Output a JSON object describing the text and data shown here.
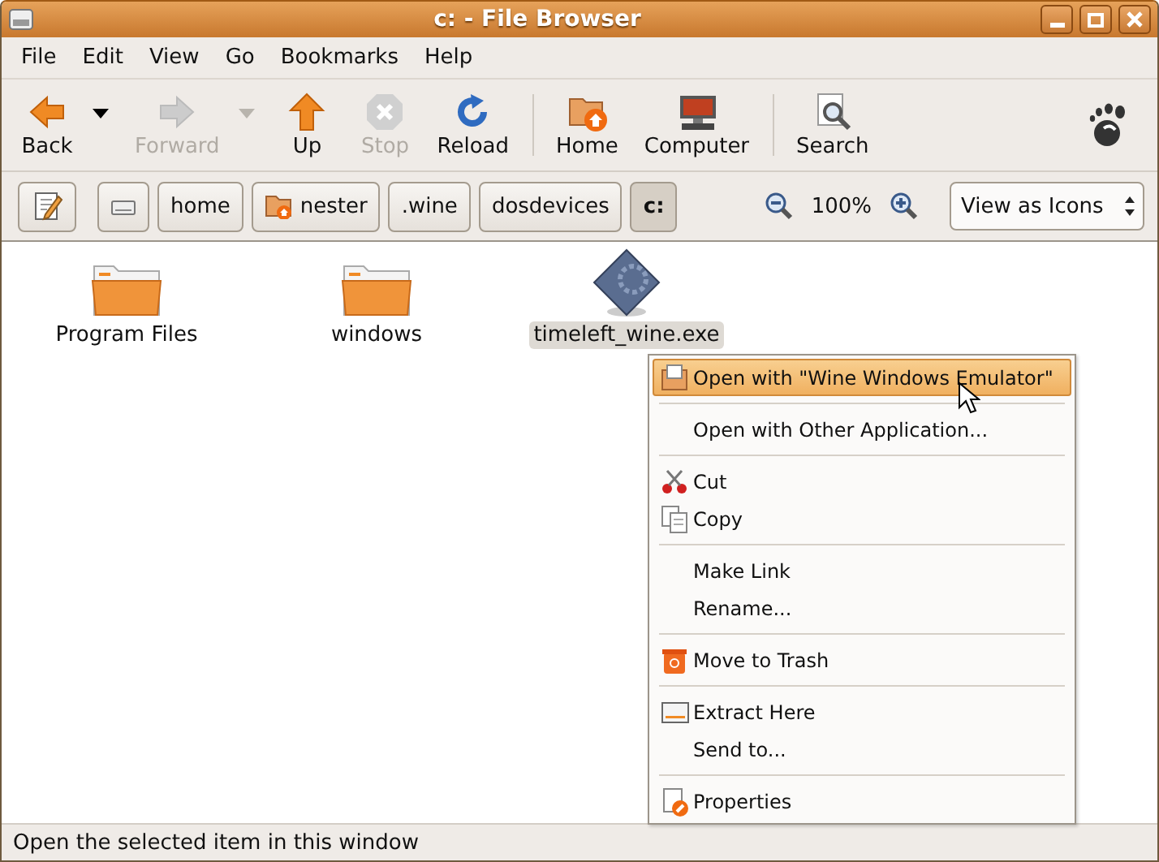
{
  "window": {
    "title": "c: - File Browser"
  },
  "menu_bar": [
    {
      "label": "File"
    },
    {
      "label": "Edit"
    },
    {
      "label": "View"
    },
    {
      "label": "Go"
    },
    {
      "label": "Bookmarks"
    },
    {
      "label": "Help"
    }
  ],
  "toolbar": [
    {
      "kind": "button",
      "label": "Back",
      "disabled": false
    },
    {
      "kind": "dropdown",
      "disabled": false
    },
    {
      "kind": "button",
      "label": "Forward",
      "disabled": true
    },
    {
      "kind": "dropdown",
      "disabled": true
    },
    {
      "kind": "button",
      "label": "Up",
      "disabled": false
    },
    {
      "kind": "button",
      "label": "Stop",
      "disabled": true
    },
    {
      "kind": "button",
      "label": "Reload",
      "disabled": false
    },
    {
      "kind": "separator"
    },
    {
      "kind": "button",
      "label": "Home",
      "disabled": false
    },
    {
      "kind": "button",
      "label": "Computer",
      "disabled": false
    },
    {
      "kind": "separator"
    },
    {
      "kind": "button",
      "label": "Search",
      "disabled": false
    },
    {
      "kind": "logo"
    }
  ],
  "location_bar": {
    "path": [
      {
        "kind": "drive",
        "selected": false
      },
      {
        "kind": "folder",
        "label": "home",
        "selected": false
      },
      {
        "kind": "home",
        "label": "nester",
        "selected": false
      },
      {
        "kind": "folder",
        "label": ".wine",
        "selected": false
      },
      {
        "kind": "folder",
        "label": "dosdevices",
        "selected": false
      },
      {
        "kind": "folder",
        "label": "c:",
        "selected": true
      }
    ],
    "zoom": "100%",
    "view": "View as Icons"
  },
  "files": [
    {
      "kind": "folder",
      "name": "Program Files",
      "selected": false
    },
    {
      "kind": "folder",
      "name": "windows",
      "selected": false
    },
    {
      "kind": "executable",
      "name": "timeleft_wine.exe",
      "selected": true
    }
  ],
  "context_menu": [
    {
      "kind": "item",
      "label": "Open with \"Wine Windows Emulator\"",
      "selected": true
    },
    {
      "kind": "separator"
    },
    {
      "kind": "item",
      "label": "Open with Other Application...",
      "selected": false
    },
    {
      "kind": "separator"
    },
    {
      "kind": "item",
      "label": "Cut",
      "selected": false
    },
    {
      "kind": "item",
      "label": "Copy",
      "selected": false
    },
    {
      "kind": "separator"
    },
    {
      "kind": "item",
      "label": "Make Link",
      "selected": false
    },
    {
      "kind": "item",
      "label": "Rename...",
      "selected": false
    },
    {
      "kind": "separator"
    },
    {
      "kind": "item",
      "label": "Move to Trash",
      "selected": false
    },
    {
      "kind": "separator"
    },
    {
      "kind": "item",
      "label": "Extract Here",
      "selected": false
    },
    {
      "kind": "item",
      "label": "Send to...",
      "selected": false
    },
    {
      "kind": "separator"
    },
    {
      "kind": "item",
      "label": "Properties",
      "selected": false
    }
  ],
  "status_bar": {
    "text": "Open the selected item in this window"
  }
}
